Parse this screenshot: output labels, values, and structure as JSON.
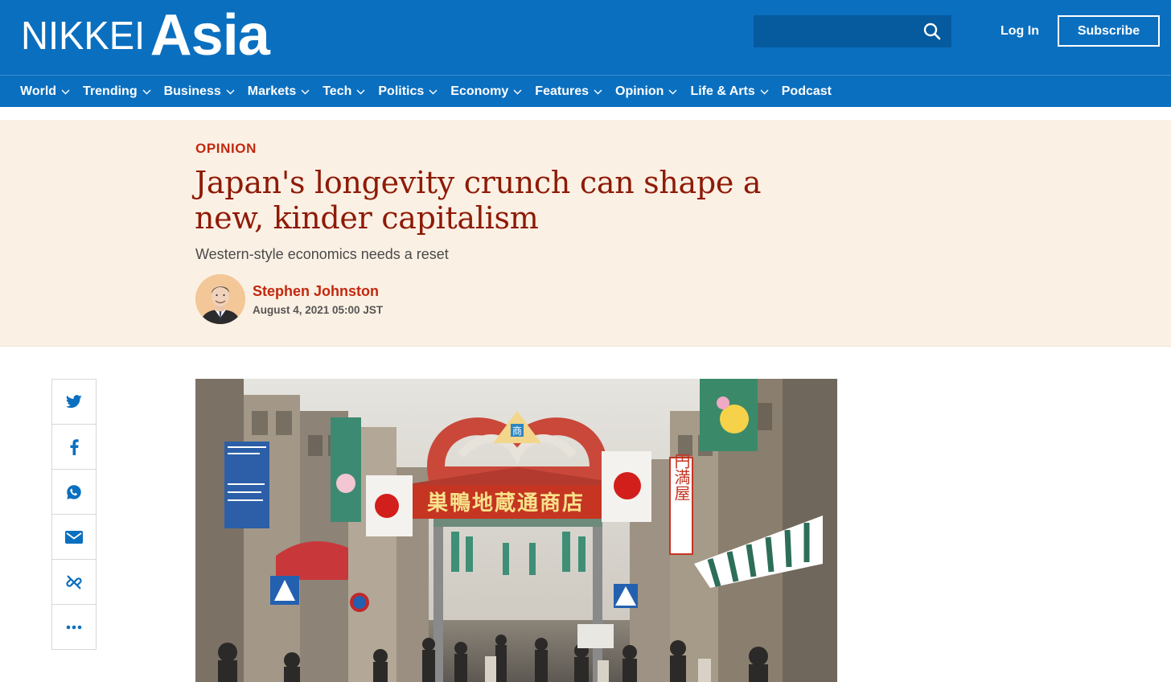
{
  "brand": {
    "part1": "NIKKEI",
    "part2": "Asia"
  },
  "search": {
    "placeholder": "",
    "value": ""
  },
  "header": {
    "login_label": "Log In",
    "subscribe_label": "Subscribe"
  },
  "nav": {
    "items": [
      {
        "label": "World",
        "dropdown": true
      },
      {
        "label": "Trending",
        "dropdown": true
      },
      {
        "label": "Business",
        "dropdown": true
      },
      {
        "label": "Markets",
        "dropdown": true
      },
      {
        "label": "Tech",
        "dropdown": true
      },
      {
        "label": "Politics",
        "dropdown": true
      },
      {
        "label": "Economy",
        "dropdown": true
      },
      {
        "label": "Features",
        "dropdown": true
      },
      {
        "label": "Opinion",
        "dropdown": true
      },
      {
        "label": "Life & Arts",
        "dropdown": true
      },
      {
        "label": "Podcast",
        "dropdown": false
      }
    ]
  },
  "article": {
    "kicker": "OPINION",
    "headline_line1": "Japan's longevity crunch can shape a",
    "headline_line2": "new, kinder capitalism",
    "subhead": "Western-style economics needs a reset",
    "author": "Stephen Johnston",
    "date": "August 4, 2021 05:00 JST",
    "photo_signs": {
      "gate": "巣鴨地蔵通商店",
      "emblem": "商",
      "vertical": "円満屋"
    }
  },
  "share": {
    "buttons": [
      "twitter-icon",
      "facebook-icon",
      "whatsapp-icon",
      "email-icon",
      "link-icon",
      "more-icon"
    ]
  },
  "colors": {
    "brand_blue": "#0b6fbf",
    "search_bg": "#065a9e",
    "hero_bg": "#fbf0e4",
    "kicker_red": "#c2280e",
    "headline_red": "#8e1a06",
    "share_icon_blue": "#0b6fbf"
  }
}
